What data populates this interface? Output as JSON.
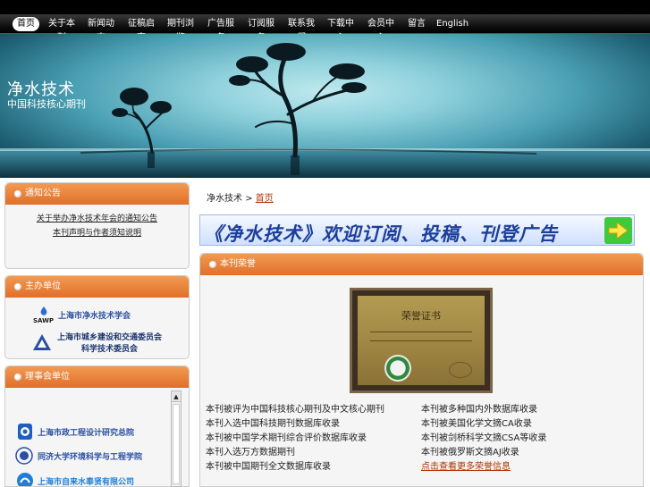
{
  "nav": {
    "items": [
      "首页",
      "关于本刊",
      "新闻动态",
      "征稿启事",
      "期刊浏览",
      "广告服务",
      "订阅服务",
      "联系我们",
      "下载中心",
      "会员中心",
      "留言",
      "English"
    ],
    "active_index": 0
  },
  "banner": {
    "title": "净水技术",
    "subtitle": "中国科技核心期刊"
  },
  "sidebar": {
    "notice": {
      "title": "通知公告",
      "links": [
        "关于举办净水技术年会的通知公告",
        "本刊声明与作者须知说明"
      ]
    },
    "sponsor": {
      "title": "主办单位",
      "logos": [
        {
          "name": "上海市净水技术学会",
          "icon": "sawp-logo-icon"
        },
        {
          "name": "上海市城乡建设和交通委员会",
          "name_line2": "科学技术委员会",
          "icon": "triangle-logo-icon"
        }
      ]
    },
    "partners": {
      "title": "理事会单位",
      "logos": [
        {
          "name": "上海市政工程设计研究总院",
          "icon": "smedi-logo-icon"
        },
        {
          "name": "同济大学环境科学与工程学院",
          "icon": "tongji-logo-icon"
        },
        {
          "name": "上海市自来水奉贤有限公司",
          "icon": "water-logo-icon"
        }
      ]
    }
  },
  "main": {
    "breadcrumb_root": "净水技术",
    "breadcrumb_sep": ">",
    "breadcrumb_current": "首页",
    "promo": "《净水技术》欢迎订阅、投稿、刊登广告",
    "section_title": "本刊荣誉",
    "certificate": {
      "title": "荣誉证书"
    },
    "left_list": [
      "本刊被评为中国科技核心期刊及中文核心期刊",
      "本刊入选中国科技期刊数据库收录",
      "本刊被中国学术期刊综合评价数据库收录",
      "本刊入选万方数据期刊",
      "本刊被中国期刊全文数据库收录"
    ],
    "right_list": [
      "本刊被多种国内外数据库收录",
      "本刊被美国化学文摘CA收录",
      "本刊被剑桥科学文摘CSA等收录",
      "本刊被俄罗斯文摘AJ收录",
      "点击查看更多荣誉信息"
    ]
  },
  "colors": {
    "nav_bg": "#111111",
    "box_header": "#e8782f",
    "link_accent": "#b03000",
    "promo_text": "#1d3f9a"
  }
}
